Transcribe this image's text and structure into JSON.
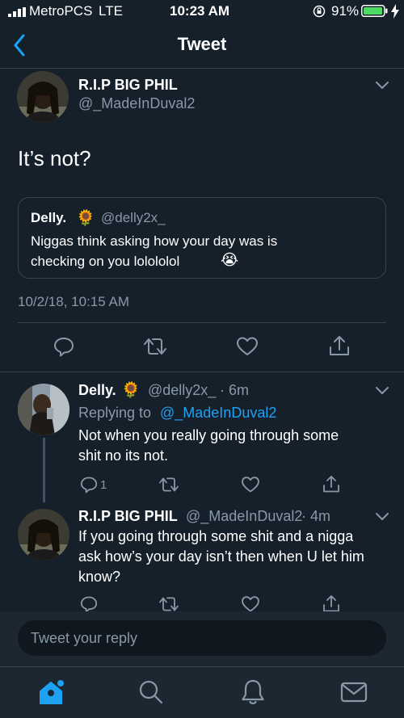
{
  "status_bar": {
    "carrier": "MetroPCS",
    "network": "LTE",
    "time": "10:23 AM",
    "battery": "91%"
  },
  "nav": {
    "title": "Tweet"
  },
  "main_tweet": {
    "display_name": "R.I.P BIG PHIL",
    "handle": "@_MadeInDuval2",
    "text": "It’s not?",
    "quote": {
      "display_name": "Delly.",
      "emoji": "🌻",
      "handle": "@delly2x_",
      "text_line1": "Niggas think asking how your day was is",
      "text_line2": "checking on you lolololol",
      "end_emoji": "😭"
    },
    "timestamp": "10/2/18, 10:15 AM"
  },
  "replies": [
    {
      "display_name": "Delly.",
      "emoji": "🌻",
      "handle": "@delly2x_",
      "age": "· 6m",
      "replying_to_label": "Replying to",
      "replying_to_handle": "@_MadeInDuval2",
      "text_line1": "Not when you really going through some",
      "text_line2": "shit no its not.",
      "reply_count": "1"
    },
    {
      "display_name": "R.I.P BIG PHIL",
      "handle": "@_MadeInDuval2",
      "age": "· 4m",
      "text_line1": "If you going through some shit and a nigga",
      "text_line2": "ask how’s your day isn’t then when U let him",
      "text_line3": "know?"
    }
  ],
  "composer": {
    "placeholder": "Tweet your reply"
  },
  "tabbar": [
    "home-icon",
    "search-icon",
    "notifications-icon",
    "messages-icon"
  ],
  "colors": {
    "background": "#15202b",
    "accent": "#1da1f2",
    "muted": "#8899a6",
    "divider": "#38444d",
    "battery": "#4cd964"
  }
}
